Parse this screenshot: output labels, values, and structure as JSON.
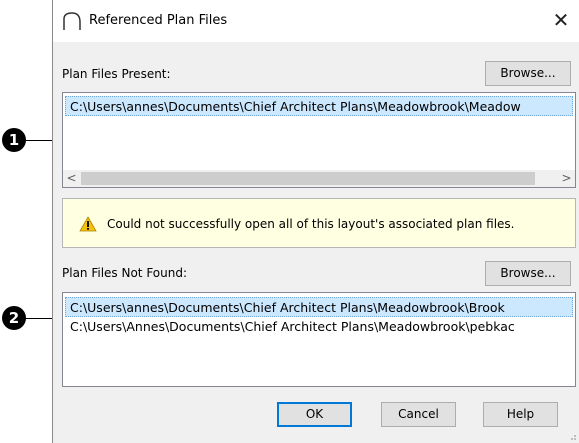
{
  "callouts": [
    "1",
    "2"
  ],
  "dialog": {
    "title": "Referenced Plan Files",
    "icon": "roof-arc-icon",
    "close_glyph": "✕"
  },
  "present": {
    "label": "Plan Files Present:",
    "browse_label": "Browse...",
    "rows": [
      "C:\\Users\\annes\\Documents\\Chief Architect Plans\\Meadowbrook\\Meadow"
    ],
    "scroll_left": "<",
    "scroll_right": ">"
  },
  "warning": {
    "icon": "warning-icon",
    "text": "Could not successfully open all of this layout's associated plan files."
  },
  "not_found": {
    "label": "Plan Files Not Found:",
    "browse_label": "Browse...",
    "rows": [
      "C:\\Users\\annes\\Documents\\Chief Architect Plans\\Meadowbrook\\Brook",
      "C:\\Users\\Annes\\Documents\\Chief Architect Plans\\Meadowbrook\\pebkac"
    ]
  },
  "footer": {
    "ok_label": "OK",
    "cancel_label": "Cancel",
    "help_label": "Help"
  }
}
